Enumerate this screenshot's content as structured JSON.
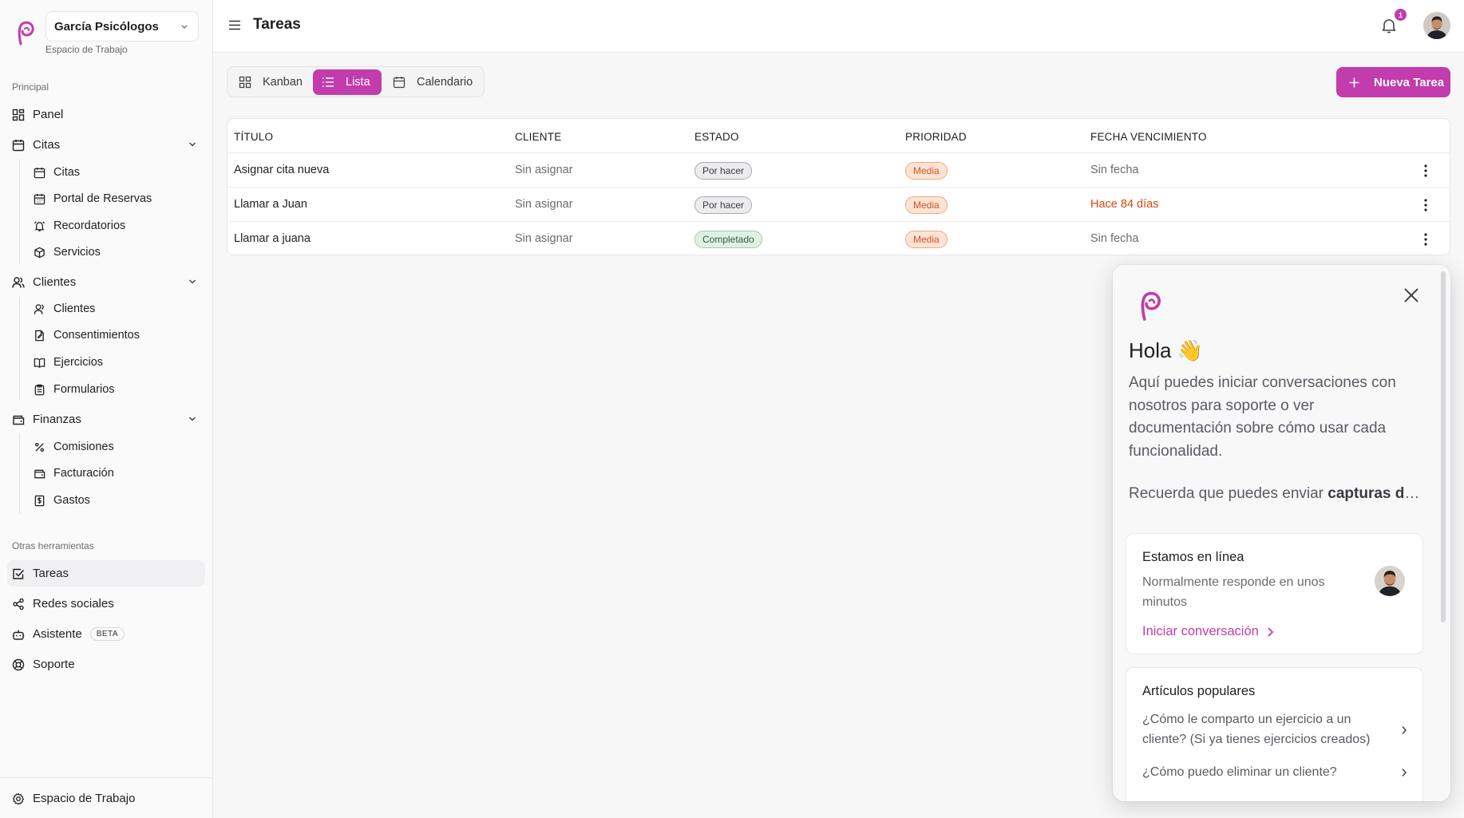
{
  "workspace": {
    "name": "García Psicólogos",
    "subtitle": "Espacio de Trabajo"
  },
  "sidebar": {
    "section_principal": "Principal",
    "panel": "Panel",
    "citas": {
      "label": "Citas",
      "children": [
        "Citas",
        "Portal de Reservas",
        "Recordatorios",
        "Servicios"
      ]
    },
    "clientes": {
      "label": "Clientes",
      "children": [
        "Clientes",
        "Consentimientos",
        "Ejercicios",
        "Formularios"
      ]
    },
    "finanzas": {
      "label": "Finanzas",
      "children": [
        "Comisiones",
        "Facturación",
        "Gastos"
      ]
    },
    "section_otras": "Otras herramientas",
    "tareas": "Tareas",
    "redes": "Redes sociales",
    "asistente": "Asistente",
    "beta": "BETA",
    "soporte": "Soporte",
    "footer": "Espacio de Trabajo"
  },
  "header": {
    "title": "Tareas",
    "notification_count": "1"
  },
  "views": {
    "kanban": "Kanban",
    "lista": "Lista",
    "calendario": "Calendario"
  },
  "new_task": "Nueva Tarea",
  "table": {
    "columns": [
      "TÍTULO",
      "CLIENTE",
      "ESTADO",
      "PRIORIDAD",
      "FECHA VENCIMIENTO"
    ],
    "rows": [
      {
        "title": "Asignar cita nueva",
        "client": "Sin asignar",
        "status": "Por hacer",
        "priority": "Media",
        "due": "Sin fecha"
      },
      {
        "title": "Llamar a Juan",
        "client": "Sin asignar",
        "status": "Por hacer",
        "priority": "Media",
        "due": "Hace 84 días"
      },
      {
        "title": "Llamar a juana",
        "client": "Sin asignar",
        "status": "Completado",
        "priority": "Media",
        "due": "Sin fecha"
      }
    ]
  },
  "widget": {
    "greeting": "Hola 👋",
    "intro": "Aquí puedes iniciar conversaciones con nosotros para soporte o ver documentación sobre cómo usar cada funcionalidad.",
    "reminder_prefix": "Recuerda que puedes enviar ",
    "reminder_bold": "capturas de pantalla",
    "online_title": "Estamos en línea",
    "online_sub": "Normalmente responde en unos minutos",
    "start_conversation": "Iniciar conversación",
    "articles_title": "Artículos populares",
    "articles": [
      "¿Cómo le comparto un ejercicio a un cliente? (Si ya tienes ejercicios creados)",
      "¿Cómo puedo eliminar un cliente?"
    ]
  },
  "colors": {
    "accent": "#c23cad",
    "danger": "#d9480f"
  }
}
